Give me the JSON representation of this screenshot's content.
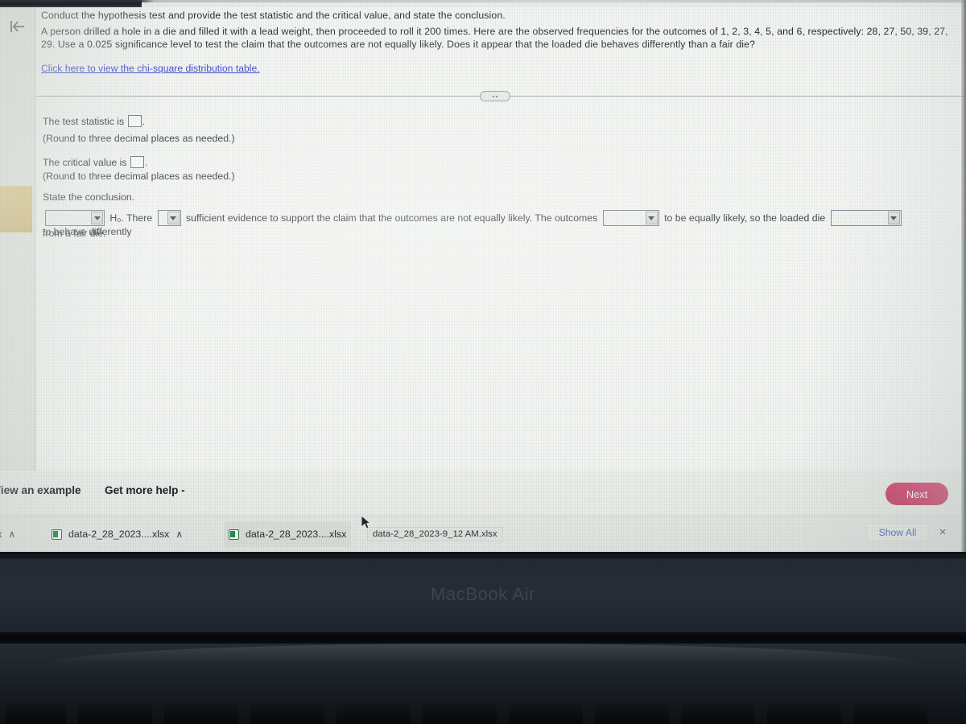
{
  "device": {
    "brand_label": "MacBook Air"
  },
  "question": {
    "line1": "Conduct the hypothesis test and provide the test statistic and the critical value, and state the conclusion.",
    "body": "A person drilled a hole in a die and filled it with a lead weight, then proceeded to roll it 200 times. Here are the observed frequencies for the outcomes of 1, 2, 3, 4, 5, and 6, respectively: 28, 27, 50, 39, 27, 29. Use a 0.025 significance level to test the claim that the outcomes are not equally likely. Does it appear that the loaded die behaves differently than a fair die?",
    "table_link": "Click here to view the chi-square distribution table.",
    "observed_frequencies": [
      28,
      27,
      50,
      39,
      27,
      29
    ],
    "outcomes": [
      1,
      2,
      3,
      4,
      5,
      6
    ],
    "rolls": 200,
    "significance_level": 0.025
  },
  "answer": {
    "test_statistic_prompt": "The test statistic is",
    "test_statistic_value": "",
    "test_statistic_round": "(Round to three decimal places as needed.)",
    "critical_value_prompt": "The critical value is",
    "critical_value_value": "",
    "critical_value_round": "(Round to three decimal places as needed.)",
    "state_conclusion": "State the conclusion."
  },
  "conclusion": {
    "dropdown_1_value": "",
    "text_1": "H₀. There",
    "dropdown_2_value": "",
    "text_2": "sufficient evidence to support the claim that the outcomes are not equally likely. The outcomes",
    "dropdown_3_value": "",
    "text_3": "to be equally likely, so the loaded die",
    "dropdown_4_value": "",
    "text_4": "to behave differently",
    "text_5": "from a fair die."
  },
  "toolbar": {
    "view_example": "View an example",
    "get_more_help": "Get more help -",
    "next_label": "Next",
    "next_color": "#c41e52"
  },
  "downloads": {
    "items": [
      {
        "name": "sx",
        "icon": "",
        "chevron": "∧"
      },
      {
        "name": "data-2_28_2023....xlsx",
        "icon": "excel-icon",
        "chevron": "∧"
      },
      {
        "name": "data-2_28_2023....xlsx",
        "icon": "excel-icon",
        "chevron": ""
      }
    ],
    "tooltip": "data-2_28_2023-9_12 AM.xlsx",
    "show_all": "Show All",
    "close": "×"
  },
  "icons": {
    "back_to_start": "back-to-start-icon",
    "ellipsis": "ellipsis-handle-icon",
    "cursor": "mouse-cursor"
  }
}
